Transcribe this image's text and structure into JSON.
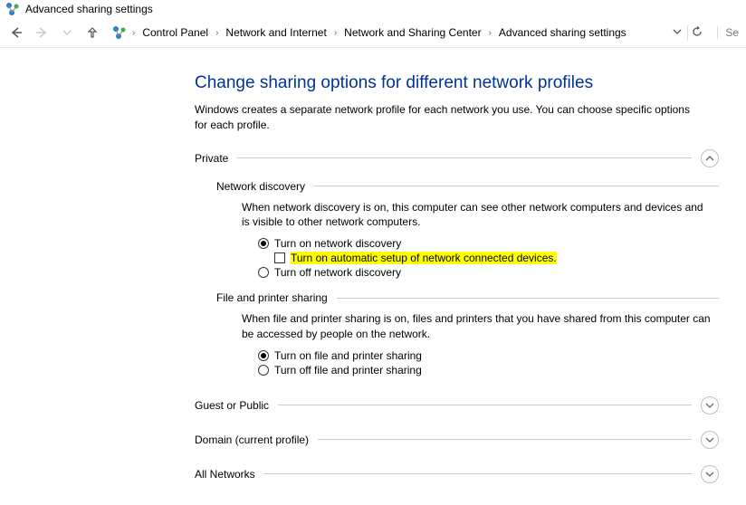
{
  "window": {
    "title": "Advanced sharing settings"
  },
  "breadcrumb": {
    "items": [
      "Control Panel",
      "Network and Internet",
      "Network and Sharing Center",
      "Advanced sharing settings"
    ]
  },
  "search": {
    "placeholder": "Se"
  },
  "page": {
    "heading": "Change sharing options for different network profiles",
    "intro": "Windows creates a separate network profile for each network you use. You can choose specific options for each profile."
  },
  "private": {
    "label": "Private",
    "network_discovery": {
      "title": "Network discovery",
      "desc": "When network discovery is on, this computer can see other network computers and devices and is visible to other network computers.",
      "turn_on_label": "Turn on network discovery",
      "auto_setup_label": "Turn on automatic setup of network connected devices.",
      "turn_off_label": "Turn off network discovery"
    },
    "file_printer": {
      "title": "File and printer sharing",
      "desc": "When file and printer sharing is on, files and printers that you have shared from this computer can be accessed by people on the network.",
      "turn_on_label": "Turn on file and printer sharing",
      "turn_off_label": "Turn off file and printer sharing"
    }
  },
  "guest": {
    "label": "Guest or Public"
  },
  "domain": {
    "label": "Domain (current profile)"
  },
  "allnet": {
    "label": "All Networks"
  }
}
